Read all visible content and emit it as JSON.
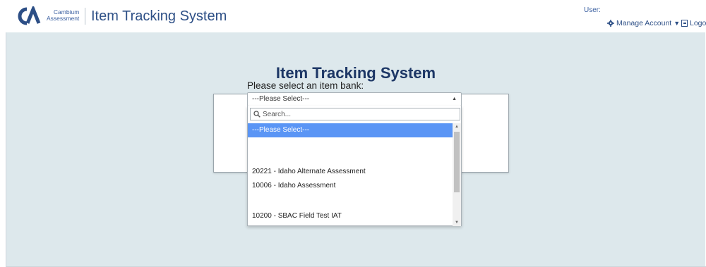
{
  "header": {
    "logo_text_line1": "Cambium",
    "logo_text_line2": "Assessment",
    "app_title": "Item Tracking System",
    "user_label": "User:",
    "manage_account": "Manage Account",
    "logout": "Logou"
  },
  "main": {
    "page_title": "Item Tracking System",
    "select_label": "Please select an item bank:",
    "selected_value": "---Please Select---",
    "search_placeholder": "Search...",
    "options": [
      "---Please Select---",
      "20221  - Idaho Alternate Assessment",
      "10006  - Idaho Assessment",
      "10200  - SBAC Field Test IAT"
    ]
  },
  "colors": {
    "brand": "#2d4f86",
    "background": "#dde8ec",
    "selected_option": "#5a95f5"
  },
  "icons": {
    "logo": "cambium-ca-logo",
    "manage": "gear-icon",
    "logout": "logout-icon",
    "search": "search-icon"
  }
}
